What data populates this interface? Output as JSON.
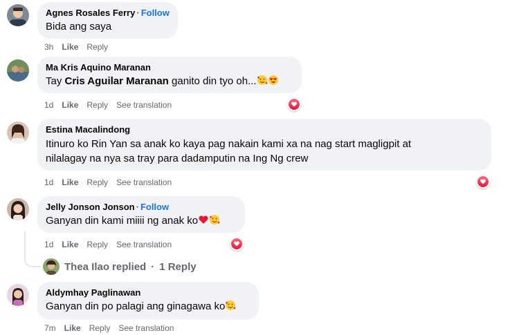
{
  "comments": [
    {
      "author": "Agnes Rosales Ferry",
      "follow": "Follow",
      "text": "Bida ang saya",
      "time": "3h",
      "like": "Like",
      "reply": "Reply"
    },
    {
      "author": "Ma Kris Aquino Maranan",
      "text_prefix": "Tay",
      "mention": "Cris Aguilar Maranan",
      "text_suffix": "ganito din tyo oh...",
      "time": "1d",
      "like": "Like",
      "reply": "Reply",
      "translate": "See translation",
      "reaction": "heart"
    },
    {
      "author": "Estina Macalindong",
      "text_line1": "Itinuro ko Rin Yan sa anak ko kaya pag nakain kami xa na nag start magligpit at",
      "text_line2": "nilalagay na nya sa tray para dadamputin na Ing Ng crew",
      "time": "1d",
      "like": "Like",
      "reply": "Reply",
      "translate": "See translation",
      "reaction": "heart"
    },
    {
      "author": "Jelly Jonson Jonson",
      "follow": "Follow",
      "text": "Ganyan din kami miiii ng anak ko",
      "time": "1d",
      "like": "Like",
      "reply": "Reply",
      "translate": "See translation",
      "reaction": "heart"
    },
    {
      "author": "Aldymhay Paglinawan",
      "text": "Ganyan din po palagi ang ginagawa ko",
      "time": "7m",
      "like": "Like",
      "reply": "Reply",
      "translate": "See translation"
    }
  ],
  "replies_summary": {
    "replier": "Thea Ilao",
    "replied_text": "replied",
    "separator": "·",
    "count_text": "1 Reply"
  },
  "colors": {
    "bubble": "#f0f2f5",
    "link": "#1b74e4",
    "meta": "#65676b",
    "heart": "#e61739"
  },
  "icons": [
    "heart-reaction-icon",
    "smiling-face-with-hearts-emoji",
    "heart-eyes-emoji",
    "red-heart-emoji"
  ]
}
